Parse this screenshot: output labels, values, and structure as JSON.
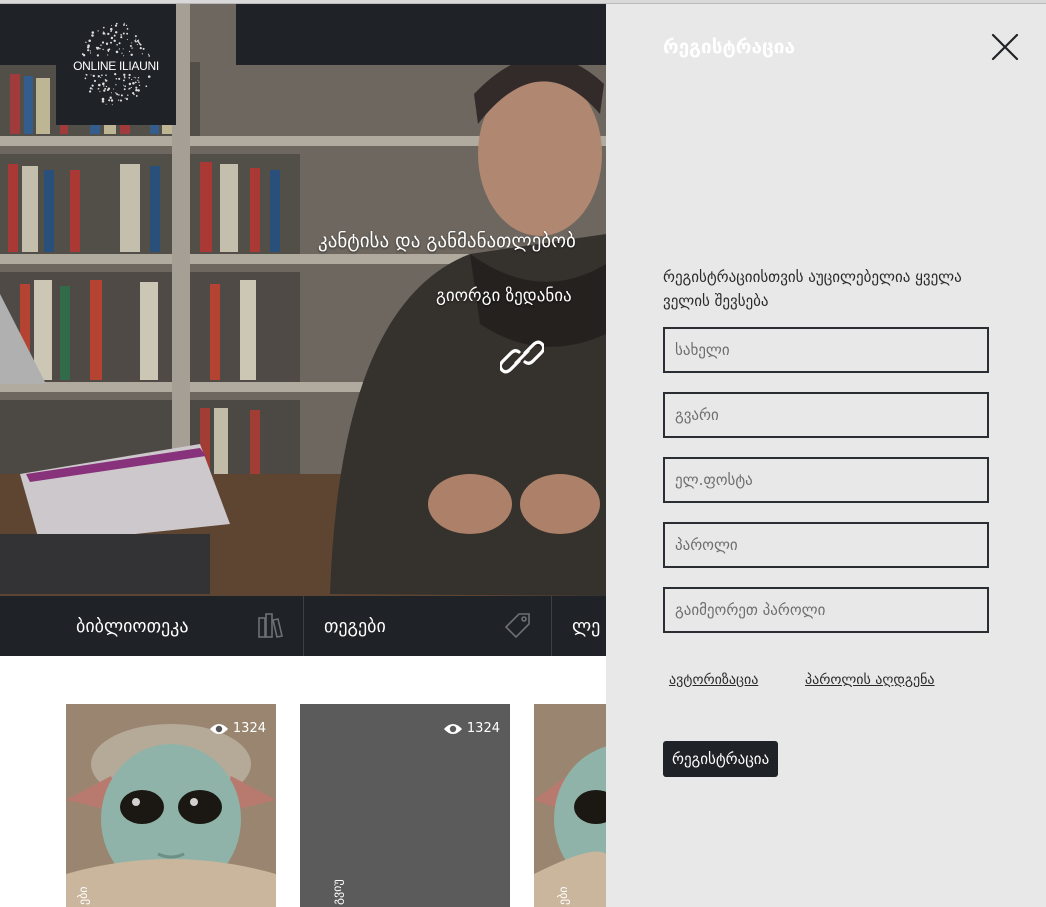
{
  "header": {
    "logo_text": "ONLINE ILIAUNI"
  },
  "hero": {
    "title": "კანტისა და განმანათლებობ",
    "author": "გიორგი ზედანია",
    "link_icon": "link-icon"
  },
  "categories": [
    {
      "label": "ბიბლიოთეკა",
      "icon": "library-icon"
    },
    {
      "label": "თეგები",
      "icon": "tag-icon"
    },
    {
      "label": "ლე",
      "icon": ""
    }
  ],
  "cards": [
    {
      "views": "1324",
      "vertical_label": "ები",
      "image": "baby-yoda"
    },
    {
      "views": "1324",
      "vertical_label": "გვიუ",
      "image": ""
    },
    {
      "views": "",
      "vertical_label": "ები",
      "image": "baby-yoda"
    }
  ],
  "registration": {
    "title": "რეგისტრაცია",
    "close_icon": "close-icon",
    "notice": "რეგისტრაციისთვის აუცილებელია ყველა ველის შევსება",
    "fields": [
      {
        "placeholder": "სახელი",
        "value": ""
      },
      {
        "placeholder": "გვარი",
        "value": ""
      },
      {
        "placeholder": "ელ.ფოსტა",
        "value": ""
      },
      {
        "placeholder": "პაროლი",
        "value": ""
      },
      {
        "placeholder": "გაიმეორეთ პაროლი",
        "value": ""
      }
    ],
    "auth_link": "ავტორიზაცია",
    "recover_link": "პაროლის აღდგენა",
    "submit_label": "რეგისტრაცია"
  },
  "colors": {
    "dark": "#1f2226",
    "panel_bg": "#e8e8e8",
    "card_gray": "#5b5b5b"
  }
}
